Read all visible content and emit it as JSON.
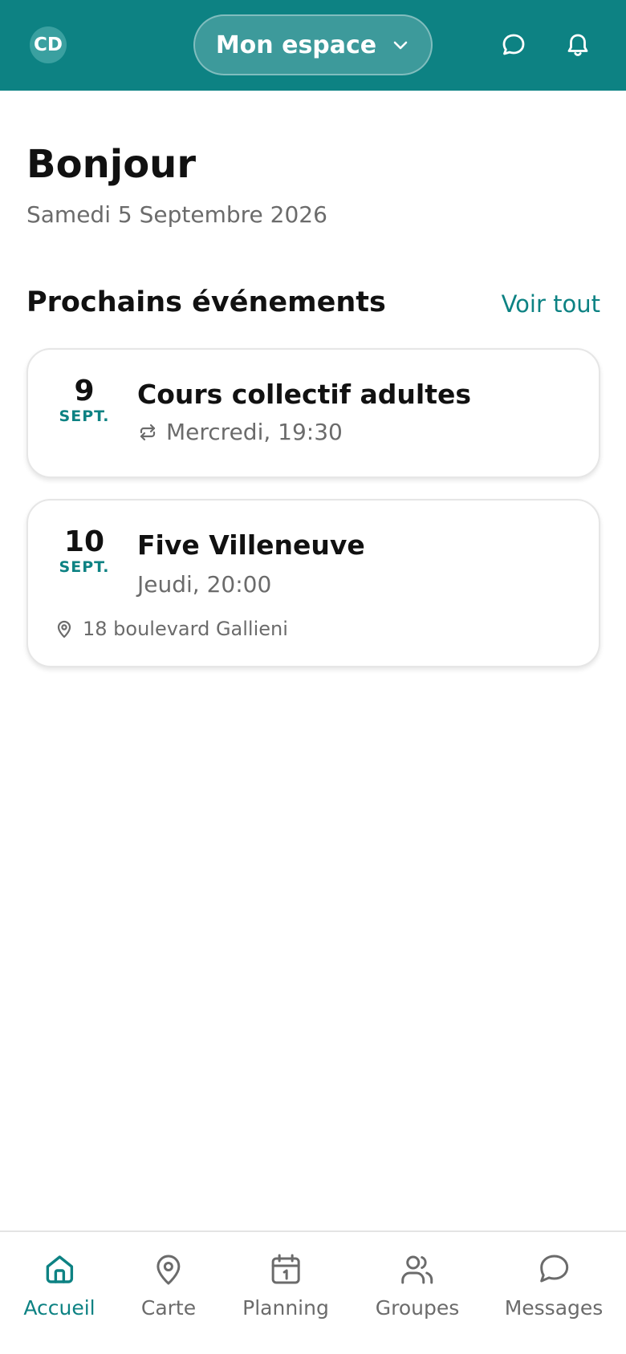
{
  "header": {
    "avatar_initials": "CD",
    "space_label": "Mon espace",
    "icons": [
      "chat-icon",
      "bell-icon"
    ]
  },
  "greeting": {
    "title": "Bonjour",
    "date": "Samedi 5 Septembre 2026"
  },
  "events_section": {
    "title": "Prochains événements",
    "see_all": "Voir tout",
    "events": [
      {
        "day": "9",
        "month": "SEPT.",
        "title": "Cours collectif adultes",
        "time": "Mercredi, 19:30",
        "recurring": true
      },
      {
        "day": "10",
        "month": "SEPT.",
        "title": "Five Villeneuve",
        "time": "Jeudi, 20:00",
        "location": "18 boulevard Gallieni"
      }
    ]
  },
  "bottom_nav": {
    "items": [
      {
        "label": "Accueil",
        "icon": "home-icon",
        "active": true
      },
      {
        "label": "Carte",
        "icon": "map-pin-icon"
      },
      {
        "label": "Planning",
        "icon": "calendar-icon"
      },
      {
        "label": "Groupes",
        "icon": "users-icon"
      },
      {
        "label": "Messages",
        "icon": "message-icon"
      }
    ]
  },
  "colors": {
    "primary": "#0d8283",
    "text": "#111111",
    "muted": "#6b6b6b"
  }
}
